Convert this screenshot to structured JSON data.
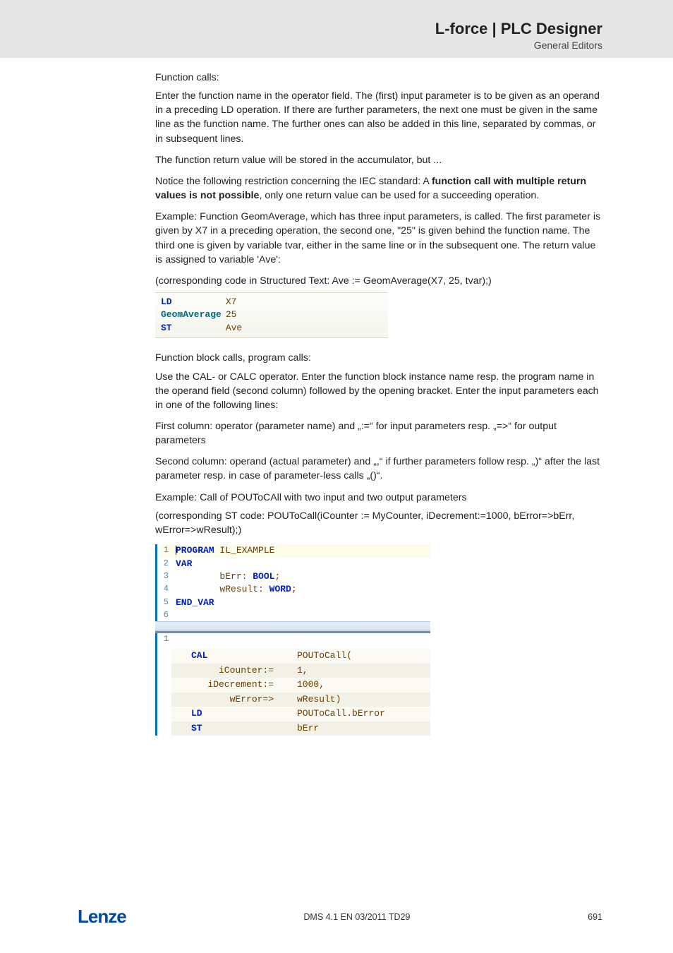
{
  "header": {
    "title": "L-force | PLC Designer",
    "subtitle": "General Editors"
  },
  "sec1": {
    "h": "Function calls:",
    "p1": "Enter the function name in the operator field. The (first) input parameter is to be given as an operand in a preceding LD operation. If there are further parameters, the next one must be given in the same line as the function name. The further ones can also be added in this line, separated by commas, or in subsequent lines.",
    "p2": "The function return value will be stored in the accumulator, but ...",
    "p3a": "Notice the following restriction concerning the IEC standard: A ",
    "p3b": "function call with multiple return values is not possible",
    "p3c": ", only one return value can be used for a succeeding operation.",
    "p4": "Example: Function GeomAverage, which has three input parameters, is called. The first parameter is given by X7 in a preceding operation, the second one, \"25\" is given behind the function name. The third one is given by variable tvar, either in the same line or in the subsequent one. The return value is assigned to variable 'Ave':",
    "p5": "(corresponding code in Structured Text: Ave := GeomAverage(X7, 25, tvar);)",
    "code": {
      "r1a": "LD",
      "r1b": "X7",
      "r2a": "GeomAverage",
      "r2b": "25",
      "r3a": "ST",
      "r3b": "Ave"
    }
  },
  "sec2": {
    "h": "Function block calls, program calls:",
    "p1": "Use the CAL- or CALC operator. Enter the function block instance name resp. the program name in the operand field (second column) followed by the opening bracket. Enter the input parameters each in one of the following lines:",
    "p2": "First column: operator (parameter name) and „:=“ for input parameters resp.   „=>“ for output parameters",
    "p3": "Second column: operand (actual parameter) and „,“ if further parameters follow resp.  „)“ after the last parameter resp. in case of parameter-less calls „()“.",
    "p4": "Example: Call of POUToCAll with two input and two output parameters",
    "p5": "(corresponding ST code: POUToCall(iCounter := MyCounter, iDecrement:=1000, bError=>bErr, wError=>wResult);)"
  },
  "editor": {
    "lines": [
      {
        "n": "1",
        "kw": "PROGRAM",
        "rest": " IL_EXAMPLE"
      },
      {
        "n": "2",
        "kw": "VAR",
        "rest": ""
      },
      {
        "n": "3",
        "indent": "        ",
        "id": "bErr",
        "colon": ": ",
        "type": "BOOL",
        "semi": ";"
      },
      {
        "n": "4",
        "indent": "        ",
        "id": "wResult",
        "colon": ": ",
        "type": "WORD",
        "semi": ";"
      },
      {
        "n": "5",
        "kw": "END_VAR",
        "rest": ""
      },
      {
        "n": "6",
        "kw": "",
        "rest": ""
      }
    ]
  },
  "lower": {
    "gut": "1",
    "rows": [
      {
        "c1": "CAL",
        "c2": "POUToCall(",
        "kw": true
      },
      {
        "c1": "     iCounter:=",
        "c2": "1,"
      },
      {
        "c1": "   iDecrement:=",
        "c2": "1000,"
      },
      {
        "c1": "       wError=>",
        "c2": "wResult)"
      },
      {
        "c1": "LD",
        "c2": "POUToCall.bError",
        "kw": true
      },
      {
        "c1": "ST",
        "c2": "bErr",
        "kw": true
      }
    ]
  },
  "footer": {
    "logo_a": "L",
    "logo_dash": "—",
    "logo_rest": "enze",
    "center": "DMS 4.1 EN 03/2011 TD29",
    "page": "691"
  }
}
